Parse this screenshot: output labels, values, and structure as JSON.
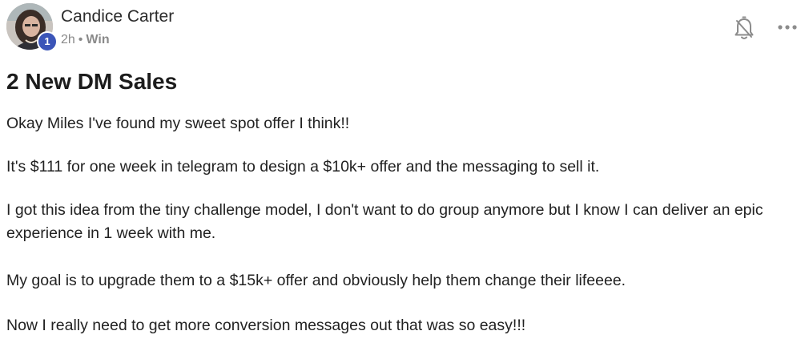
{
  "post": {
    "author": {
      "name": "Candice Carter",
      "level": "1",
      "avatar": "profile-photo"
    },
    "meta": {
      "time": "2h",
      "separator": "•",
      "category": "Win"
    },
    "actions": {
      "bell_icon": "bell-off-icon",
      "more_icon": "more-horizontal-icon"
    },
    "title": "2 New DM Sales",
    "paragraphs": [
      "Okay Miles I've found my sweet spot offer I think!!",
      "It's $111 for one week in telegram to design a $10k+ offer and the messaging to sell it.",
      "I got this idea from the tiny challenge model, I don't want to do group anymore but I know I can deliver an epic experience in 1 week with me.",
      "My goal is to upgrade them to a $15k+ offer and obviously help them change their lifeeee.",
      "Now I really need to get more conversion messages out that was so easy!!!"
    ]
  },
  "colors": {
    "badge": "#3b55b8",
    "text": "#222222",
    "muted": "#8a8a8a"
  }
}
